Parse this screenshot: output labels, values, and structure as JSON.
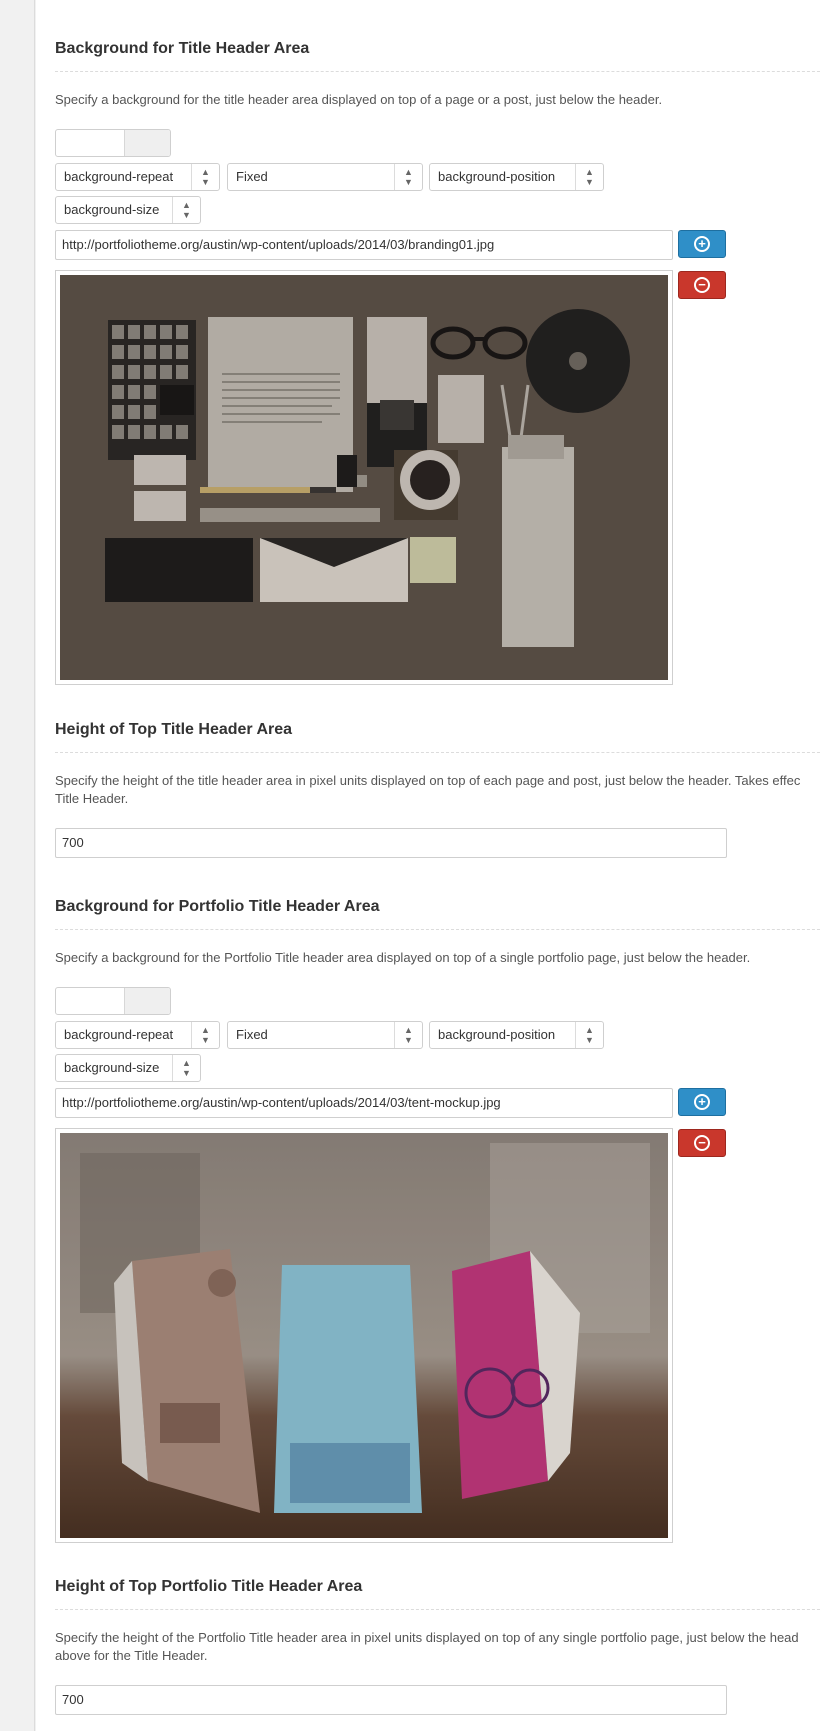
{
  "title_header_bg": {
    "title": "Background for Title Header Area",
    "description": "Specify a background for the title header area displayed on top of a page or a post, just below the header.",
    "repeat_select": "background-repeat",
    "attachment_select": "Fixed",
    "position_select": "background-position",
    "size_select": "background-size",
    "url": "http://portfoliotheme.org/austin/wp-content/uploads/2014/03/branding01.jpg",
    "preview_alt": "branding mockup"
  },
  "title_header_height": {
    "title": "Height of Top Title Header Area",
    "description_line1": "Specify the height of the title header area in pixel units displayed on top of each page and post, just below the header. Takes effec",
    "description_line2": "Title Header.",
    "value": "700"
  },
  "portfolio_header_bg": {
    "title": "Background for Portfolio Title Header Area",
    "description": "Specify a background for the Portfolio Title header area displayed on top of a single portfolio page, just below the header.",
    "repeat_select": "background-repeat",
    "attachment_select": "Fixed",
    "position_select": "background-position",
    "size_select": "background-size",
    "url": "http://portfoliotheme.org/austin/wp-content/uploads/2014/03/tent-mockup.jpg",
    "preview_alt": "tent card mockup"
  },
  "portfolio_header_height": {
    "title": "Height of Top Portfolio Title Header Area",
    "description_line1": "Specify the height of the Portfolio Title header area in pixel units displayed on top of any single portfolio page, just below the head",
    "description_line2": "above for the Title Header.",
    "value": "700"
  },
  "icons": {
    "add": "plus-circle-icon",
    "remove": "minus-circle-icon",
    "select_arrow": "updown-arrows-icon"
  },
  "colors": {
    "add_button": "#2f8fc8",
    "remove_button": "#c9372c"
  }
}
